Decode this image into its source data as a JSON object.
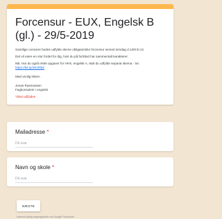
{
  "form": {
    "title": "Forcensur - EUX, Engelsk B (gl.) - 29/5-2019",
    "description": {
      "line1": "Samtlige censorer bedes udfylde denne obligatoriske forcensur senest torsdag d.13/6 kl.12.",
      "line2": "Det vil være en stor fordel for dig, hvis du på forhånd har sammentalt karakterer.",
      "line3": "NB. Har du også rettet opgaver for HHX, engelsk A, skal du udfylde separat skema - Se:",
      "link": "https://bit.ly/2R1f6b6",
      "greeting": "Med venlig hilsen",
      "name": "Jonas Rasmussen",
      "role": "Fagkonsulent i engelsk"
    },
    "required_note": "*Skal udfyldes"
  },
  "questions": [
    {
      "label": "Mailadresse",
      "required_mark": "*",
      "placeholder": "Dit svar"
    },
    {
      "label": "Navn og skole",
      "required_mark": "*",
      "placeholder": "Dit svar"
    }
  ],
  "buttons": {
    "next": "NÆSTE"
  },
  "footer": {
    "text": "Indsend aldrig adgangskoder via Google Formularer."
  },
  "colors": {
    "accent": "#ffb74d",
    "background": "#f2e5d2",
    "required": "#d93025",
    "link": "#1a73e8"
  }
}
